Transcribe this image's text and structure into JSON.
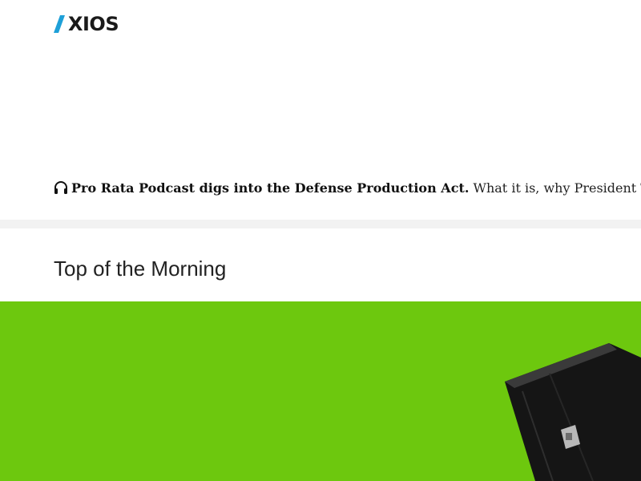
{
  "brand": {
    "name": "XIOS",
    "accent_color": "#1ea0d8"
  },
  "promo": {
    "icon": "headphones-icon",
    "headline": "Pro Rata Podcast digs into the Defense Production Act.",
    "text": "What it is, why President Tru"
  },
  "section": {
    "title": "Top of the Morning"
  },
  "hero": {
    "background_color": "#6dc80e",
    "image": "briefcase-illustration"
  }
}
